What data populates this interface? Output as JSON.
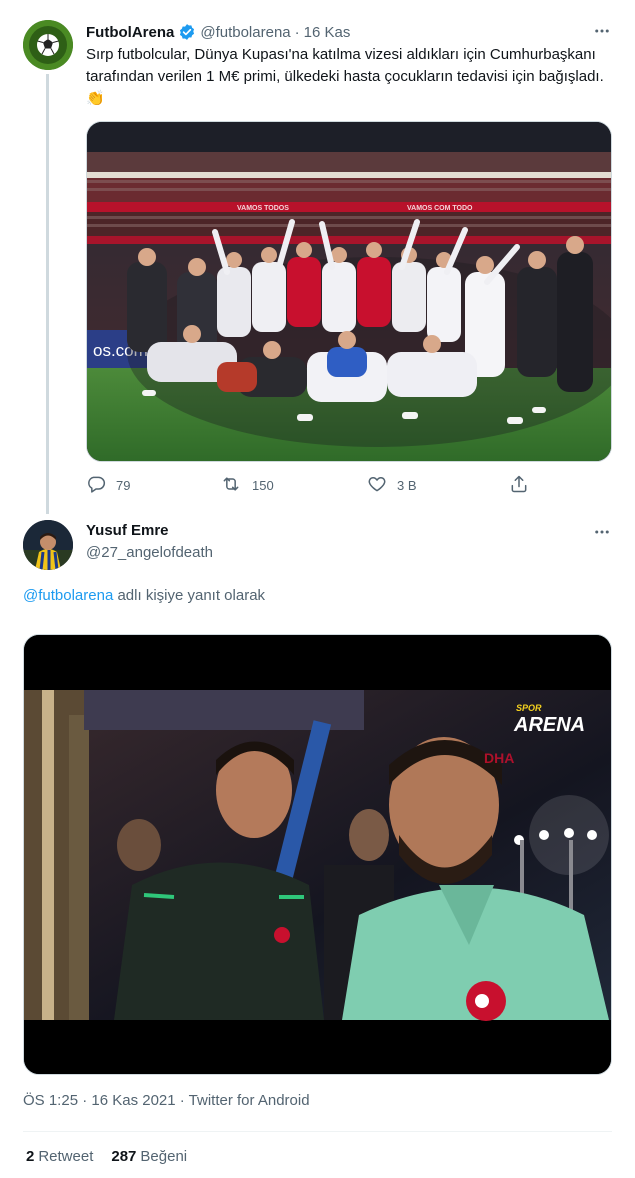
{
  "tweet": {
    "author_name": "FutbolArena",
    "handle": "@futbolarena",
    "date": "16 Kas",
    "text": "Sırp futbolcular, Dünya Kupası'na katılma vizesi aldıkları için Cumhurbaşkanı tarafından verilen 1 M€ primi, ülkedeki hasta çocukların tedavisi için bağışladı. 👏",
    "photo_banner_left": "VAMOS TODOS",
    "photo_banner_right": "VAMOS COM TODO",
    "photo_board": "os.com",
    "replies": "79",
    "retweets": "150",
    "likes": "3 B"
  },
  "reply": {
    "author_name": "Yusuf Emre",
    "handle": "@27_angelofdeath",
    "reply_prefix": "@futbolarena",
    "reply_suffix": " adlı kişiye yanıt olarak",
    "video_logo_top": "SPOR",
    "video_logo_bottom": "ARENA",
    "video_watermark": "DHA",
    "timestamp": "ÖS 1:25 · 16 Kas 2021 · Twitter for Android",
    "retweet_count": "2",
    "retweet_label": "Retweet",
    "like_count": "287",
    "like_label": "Beğeni"
  },
  "colors": {
    "accent": "#1d9bf0",
    "muted": "#536471",
    "text": "#0f1419",
    "pitch": "#3f7f35",
    "jersey_red": "#c8102e"
  },
  "icons": [
    "verified-badge-icon",
    "more-icon",
    "reply-icon",
    "retweet-icon",
    "like-icon",
    "share-icon"
  ]
}
